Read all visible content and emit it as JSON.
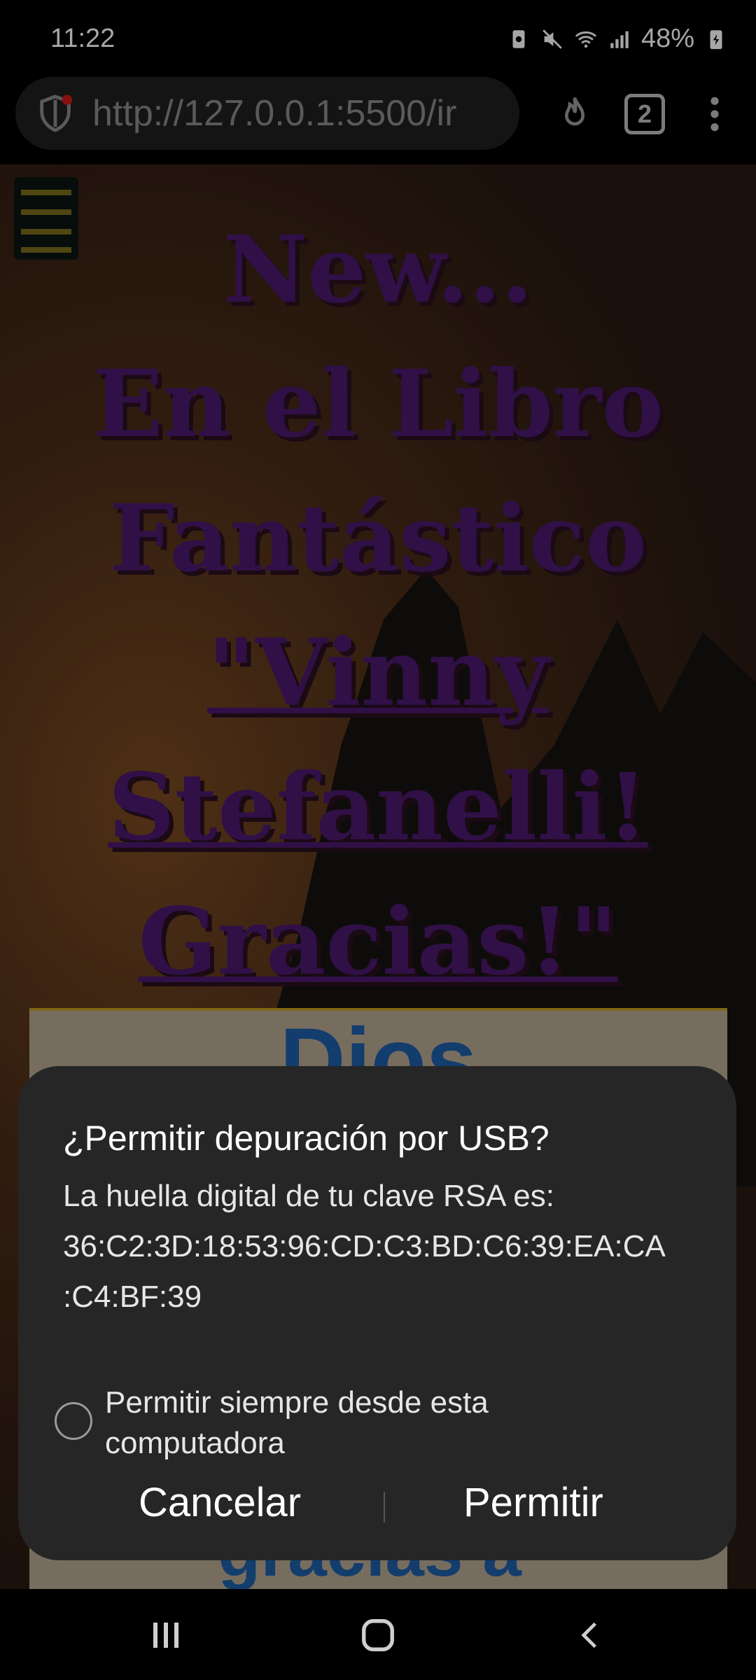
{
  "status_bar": {
    "time": "11:22",
    "battery": "48%",
    "icons": [
      "recycle-battery-icon",
      "mute-icon",
      "wifi-icon",
      "signal-icon",
      "charging-battery-icon"
    ]
  },
  "browser": {
    "url": "http://127.0.0.1:5500/ir",
    "tab_count": "2",
    "icons": [
      "shield-icon",
      "flame-icon",
      "tabs-icon",
      "more-vert-icon"
    ]
  },
  "page": {
    "headline_lines": [
      "New...",
      "En el Libro",
      "Fantástico",
      "\"Vinny",
      "Stefanelli!",
      "Gracias!\""
    ],
    "card_text": "Dios",
    "card_bottom_text": "gracias a'"
  },
  "dialog": {
    "title": "¿Permitir depuración por USB?",
    "body_line1": "La huella digital de tu clave RSA es:",
    "fingerprint_line1": "36:C2:3D:18:53:96:CD:C3:BD:C6:39:EA:CA",
    "fingerprint_line2": ":C4:BF:39",
    "checkbox_label": "Permitir siempre desde esta computadora",
    "cancel_label": "Cancelar",
    "allow_label": "Permitir"
  },
  "nav": {
    "icons": [
      "recents-icon",
      "home-icon",
      "back-icon"
    ]
  },
  "colors": {
    "headline": "#4a1a6e",
    "card_text": "#1e5fa8",
    "dialog_bg": "#262626"
  }
}
